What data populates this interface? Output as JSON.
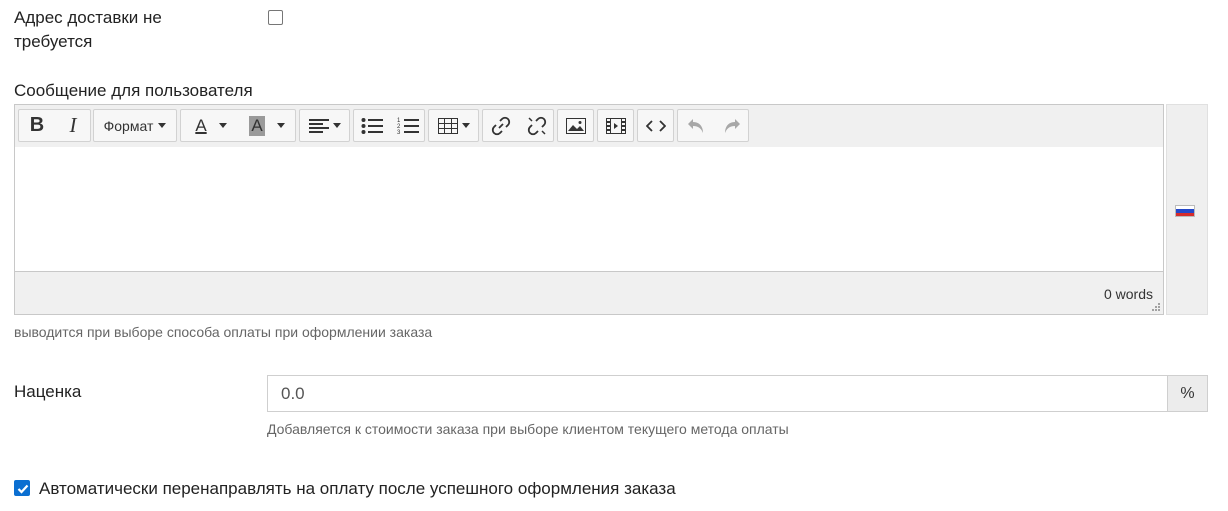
{
  "no_delivery": {
    "label": "Адрес доставки не требуется",
    "checked": false
  },
  "user_message": {
    "label": "Сообщение для пользователя",
    "toolbar": {
      "bold": "B",
      "italic": "I",
      "format": "Формат",
      "text_color": "A",
      "bg_color": "A"
    },
    "word_count": "0 words",
    "language_flag": "russia-flag-icon",
    "hint": "выводится при выборе способа оплаты при оформлении заказа"
  },
  "markup": {
    "label": "Наценка",
    "value": "0.0",
    "addon": "%",
    "hint": "Добавляется к стоимости заказа при выборе клиентом текущего метода оплаты"
  },
  "auto_redirect": {
    "label": "Автоматически перенаправлять на оплату после успешного оформления заказа",
    "checked": true
  },
  "colors": {
    "accent": "#0b6fd1",
    "toolbar_bg": "#f0f0f0",
    "border": "#c8c8c8"
  }
}
